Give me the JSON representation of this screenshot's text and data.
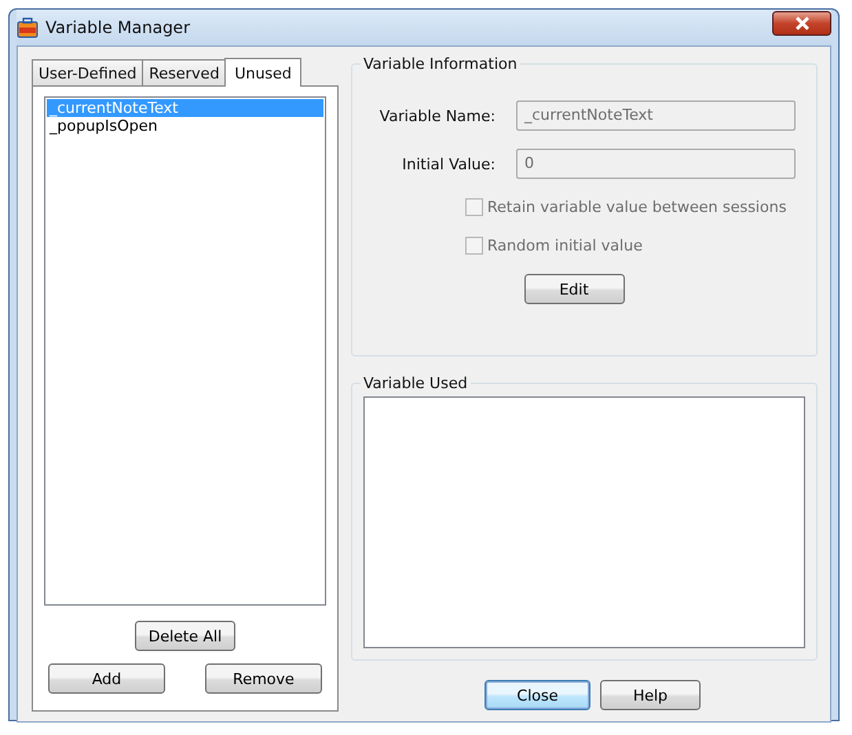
{
  "window": {
    "title": "Variable Manager"
  },
  "tabs": [
    {
      "label": "User-Defined",
      "selected": false
    },
    {
      "label": "Reserved",
      "selected": false
    },
    {
      "label": "Unused",
      "selected": true
    }
  ],
  "variables": [
    {
      "name": "_currentNoteText",
      "selected": true
    },
    {
      "name": "_popupIsOpen",
      "selected": false
    }
  ],
  "list_buttons": {
    "delete_all": "Delete All",
    "add": "Add",
    "remove": "Remove"
  },
  "variable_information": {
    "title": "Variable Information",
    "fields": [
      {
        "label": "Variable Name:",
        "value": "_currentNoteText",
        "disabled": true
      },
      {
        "label": "Initial Value:",
        "value": "0",
        "disabled": true
      }
    ],
    "checkboxes": [
      {
        "label": "Retain variable value between sessions",
        "checked": false,
        "disabled": true
      },
      {
        "label": "Random initial value",
        "checked": false,
        "disabled": true
      }
    ],
    "edit_button": "Edit"
  },
  "variable_used": {
    "title": "Variable Used"
  },
  "buttons": [
    {
      "label": "Close",
      "default": true
    },
    {
      "label": "Help",
      "default": false
    }
  ]
}
